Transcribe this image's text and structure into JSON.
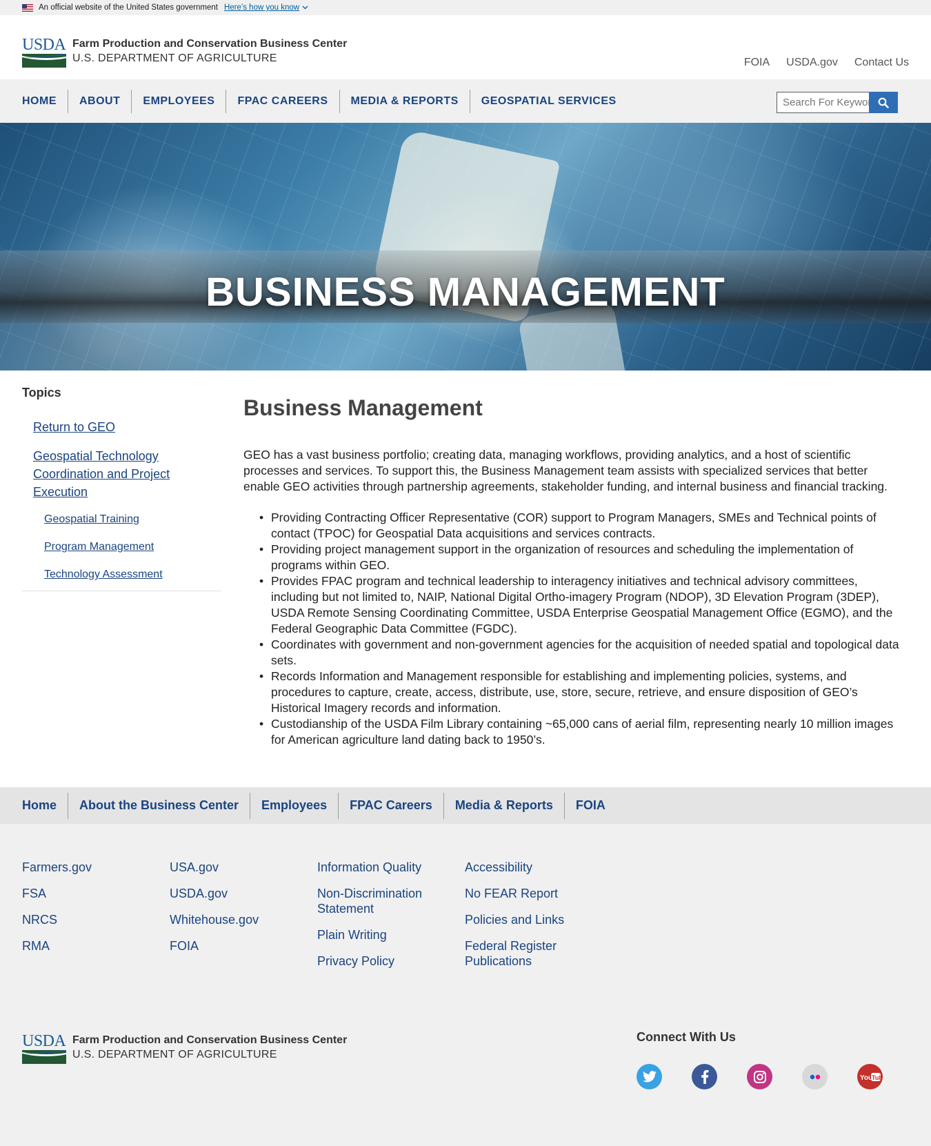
{
  "gov_banner": {
    "text": "An official website of the United States government",
    "link": "Here’s how you know"
  },
  "header": {
    "org_name": "Farm Production and Conservation Business Center",
    "dept": "U.S. DEPARTMENT OF AGRICULTURE",
    "logo_text": "USDA",
    "util_links": [
      "FOIA",
      "USDA.gov",
      "Contact Us"
    ]
  },
  "nav": {
    "items": [
      "HOME",
      "ABOUT",
      "EMPLOYEES",
      "FPAC CAREERS",
      "MEDIA & REPORTS",
      "GEOSPATIAL SERVICES"
    ],
    "search_placeholder": "Search For Keywords"
  },
  "hero": {
    "title": "BUSINESS MANAGEMENT"
  },
  "sidebar": {
    "title": "Topics",
    "links": [
      "Return to GEO",
      "Geospatial Technology Coordination and Project Execution"
    ],
    "sub_links": [
      "Geospatial Training",
      "Program Management",
      "Technology Assessment"
    ]
  },
  "article": {
    "title": "Business Management",
    "intro": "GEO has a vast business portfolio; creating data, managing workflows, providing analytics, and a host of scientific processes and services. To support this, the Business Management team assists with specialized services that better enable GEO activities through partnership agreements, stakeholder funding, and internal business and financial tracking.",
    "bullets": [
      "Providing Contracting Officer Representative (COR) support to Program Managers, SMEs and Technical points of contact (TPOC) for Geospatial Data acquisitions and services contracts.",
      "Providing project management support in the organization of resources and scheduling the implementation of programs within GEO.",
      "Provides FPAC program and technical leadership to interagency initiatives and technical advisory committees, including but not limited to, NAIP, National Digital Ortho-imagery Program (NDOP), 3D Elevation Program (3DEP), USDA Remote Sensing Coordinating Committee, USDA Enterprise Geospatial Management Office (EGMO), and the Federal Geographic Data Committee (FGDC).",
      "Coordinates with government and non-government agencies for the acquisition of needed spatial and topological data sets.",
      "Records Information and Management responsible for establishing and implementing policies, systems, and procedures to capture, create, access, distribute, use, store, secure, retrieve, and ensure disposition of GEO’s Historical Imagery records and information.",
      "Custodianship of the USDA Film Library containing ~65,000 cans of aerial film, representing nearly 10 million images for American agriculture land dating back to 1950’s."
    ]
  },
  "footer_nav": [
    "Home",
    "About the Business Center",
    "Employees",
    "FPAC Careers",
    "Media & Reports",
    "FOIA"
  ],
  "footer_links": {
    "col1": [
      "Farmers.gov",
      "FSA",
      "NRCS",
      "RMA"
    ],
    "col2": [
      "USA.gov",
      "USDA.gov",
      "Whitehouse.gov",
      "FOIA"
    ],
    "col3": [
      "Information Quality",
      "Non-Discrimination Statement",
      "Plain Writing",
      "Privacy Policy"
    ],
    "col4": [
      "Accessibility",
      "No FEAR Report",
      "Policies and Links",
      "Federal Register Publications"
    ]
  },
  "connect": {
    "title": "Connect With Us",
    "socials": [
      {
        "icon": "twitter-icon",
        "color": "#3aa2e3"
      },
      {
        "icon": "facebook-icon",
        "color": "#3b5998"
      },
      {
        "icon": "instagram-icon",
        "color": "#c13584"
      },
      {
        "icon": "flickr-icon",
        "color": "#d8d8d8"
      },
      {
        "icon": "youtube-icon",
        "color": "#c4302b"
      }
    ]
  },
  "colors": {
    "nav_text": "#1a4480",
    "link": "#1a4480",
    "search_button": "#2e6eb5",
    "usda_blue": "#1a5a96",
    "usda_green": "#215732"
  }
}
